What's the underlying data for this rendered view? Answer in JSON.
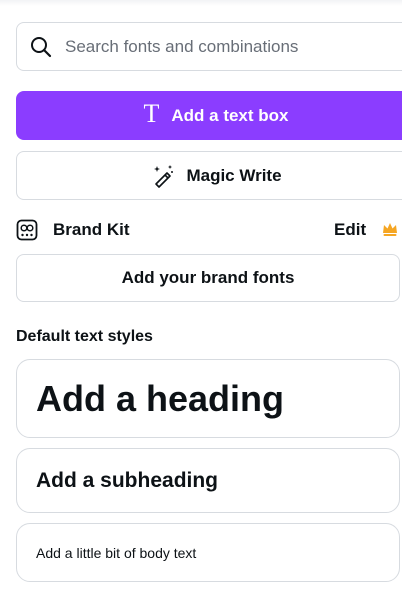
{
  "search": {
    "placeholder": "Search fonts and combinations",
    "value": ""
  },
  "actions": {
    "add_text_box": "Add a text box",
    "magic_write": "Magic Write"
  },
  "brand_kit": {
    "label": "Brand Kit",
    "edit": "Edit",
    "add_fonts": "Add your brand fonts"
  },
  "default_styles": {
    "title": "Default text styles",
    "heading": "Add a heading",
    "subheading": "Add a subheading",
    "body": "Add a little bit of body text"
  },
  "colors": {
    "primary": "#8b3dff",
    "border": "#d7dbe0",
    "text": "#0d1216",
    "muted": "#686e77",
    "crown": "#f5a623"
  },
  "icons": {
    "search": "search-icon",
    "text": "text-t-icon",
    "magic": "magic-wand-icon",
    "brand_kit": "brand-kit-icon",
    "crown": "crown-icon"
  }
}
